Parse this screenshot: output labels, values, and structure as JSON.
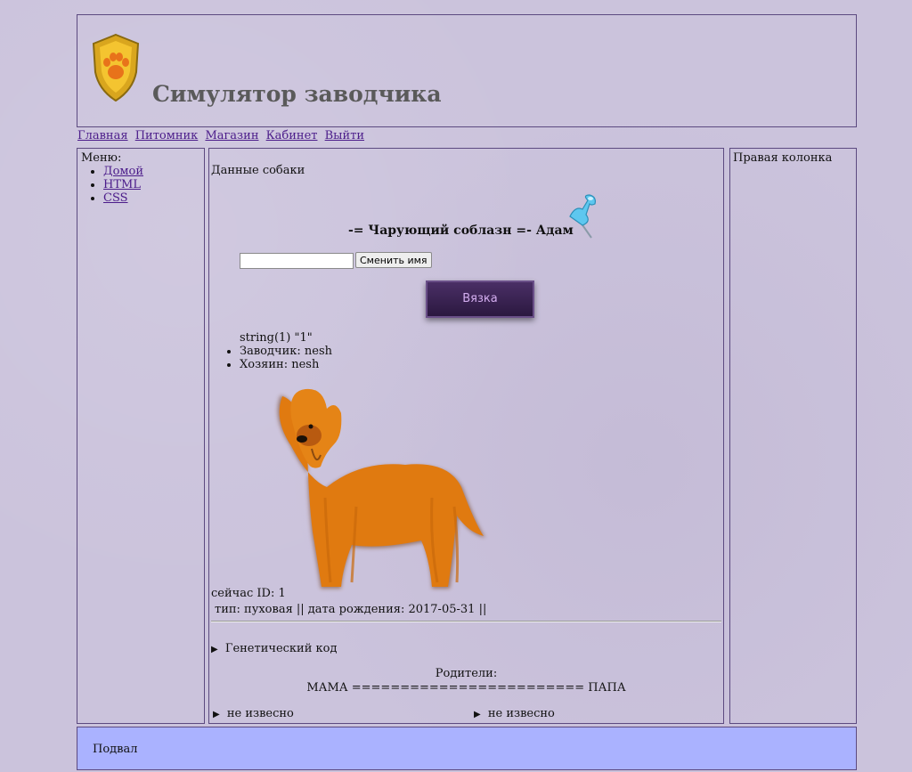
{
  "header": {
    "title": "Симулятор заводчика"
  },
  "nav": [
    {
      "label": "Главная"
    },
    {
      "label": "Питомник"
    },
    {
      "label": "Магазин"
    },
    {
      "label": "Кабинет"
    },
    {
      "label": "Выйти"
    }
  ],
  "sidebar": {
    "title": "Меню:",
    "items": [
      {
        "label": "Домой"
      },
      {
        "label": "HTML"
      },
      {
        "label": "CSS"
      }
    ]
  },
  "main": {
    "section_title": "Данные собаки",
    "dog_title": "-= Чарующий соблазн =- Адам",
    "name_input_value": "",
    "rename_button": "Сменить имя",
    "mate_button": "Вязка",
    "debug_text": "string(1) \"1\"",
    "info": [
      {
        "text": "Заводчик: nesh"
      },
      {
        "text": "Хозяин: nesh"
      }
    ],
    "current_id": "сейчас ID: 1",
    "meta": "тип: пуховая || дата рождения: 2017-05-31 ||",
    "genetic_label": "Генетический код",
    "parents_label": "Родители:",
    "parents_line": "МАМА ======================== ПАПА",
    "mother": "не извесно",
    "father": "не извесно"
  },
  "right": {
    "title": "Правая колонка"
  },
  "footer": {
    "text": "Подвал"
  },
  "colors": {
    "background": "#cbc3dc",
    "footer": "#aab2ff",
    "dog": "#e07a10",
    "button": "#3a2352"
  },
  "icons": {
    "logo": "paw-shield-icon",
    "pin": "pushpin-icon",
    "expand": "triangle-right-icon"
  }
}
